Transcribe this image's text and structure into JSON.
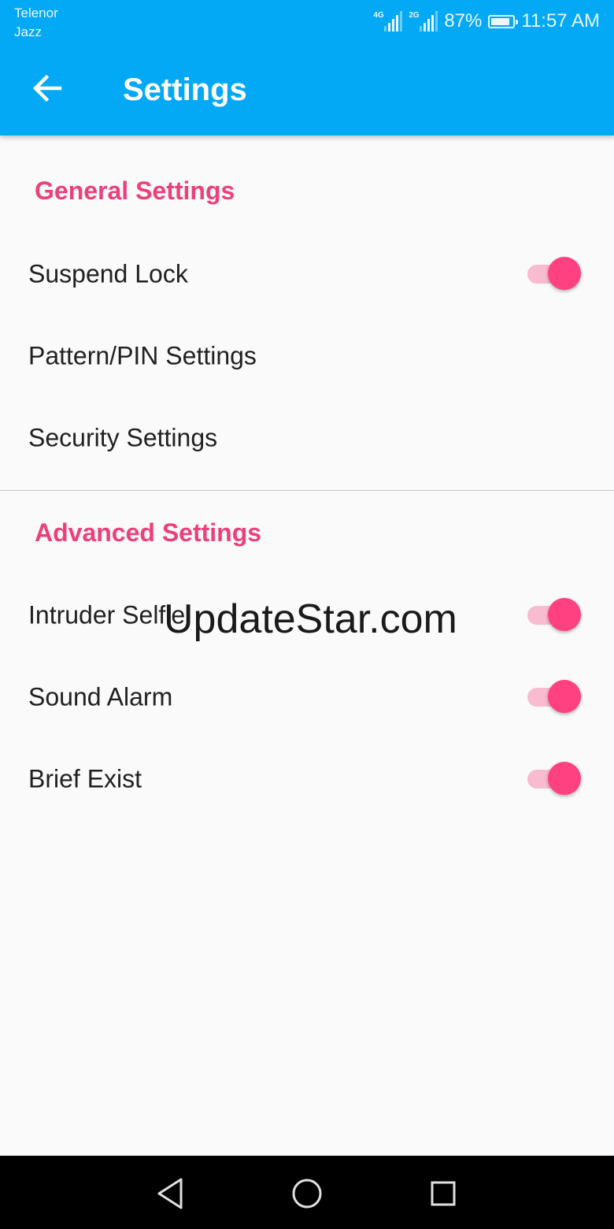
{
  "status_bar": {
    "carrier_line1": "Telenor",
    "carrier_line2": "Jazz",
    "network1": "4G",
    "network2": "2G",
    "battery_percent": "87%",
    "battery_level": 0.87,
    "time": "11:57 AM"
  },
  "app_bar": {
    "title": "Settings",
    "background_color": "#03a9f4",
    "back_icon": "arrow-left-icon"
  },
  "sections": [
    {
      "header": "General Settings",
      "items": [
        {
          "label": "Suspend Lock",
          "toggle": true,
          "on": true
        },
        {
          "label": "Pattern/PIN Settings",
          "toggle": false
        },
        {
          "label": "Security Settings",
          "toggle": false
        }
      ]
    },
    {
      "header": "Advanced Settings",
      "items": [
        {
          "label": "Intruder Selfie",
          "toggle": true,
          "on": true
        },
        {
          "label": "Sound Alarm",
          "toggle": true,
          "on": true
        },
        {
          "label": "Brief Exist",
          "toggle": true,
          "on": true
        }
      ]
    }
  ],
  "accent_color": "#ec407a",
  "switch_color": "#ff4081",
  "watermark": "UpdateStar.com",
  "nav_bar": {
    "back_icon": "triangle-back-icon",
    "home_icon": "circle-home-icon",
    "recents_icon": "square-recents-icon"
  }
}
